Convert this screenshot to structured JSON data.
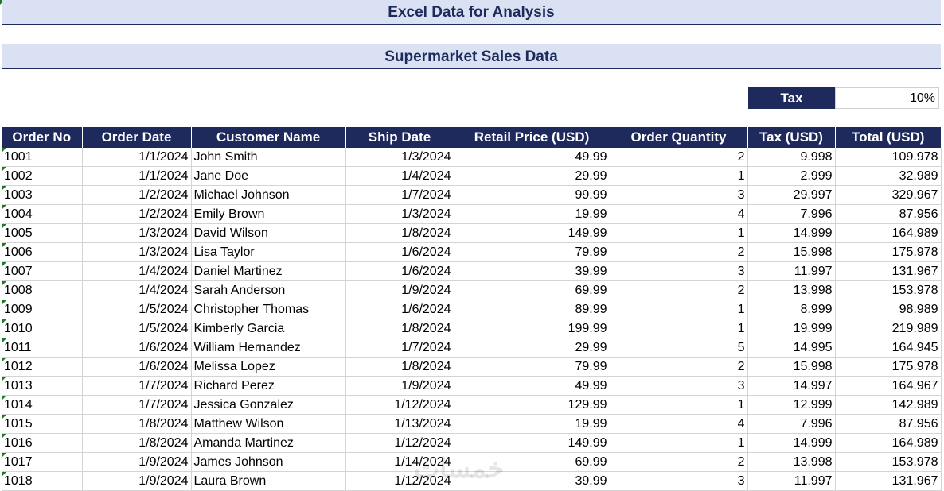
{
  "title": "Excel Data for Analysis",
  "subtitle": "Supermarket Sales Data",
  "tax": {
    "label": "Tax",
    "value": "10%"
  },
  "table": {
    "headers": [
      "Order No",
      "Order Date",
      "Customer Name",
      "Ship Date",
      "Retail Price (USD)",
      "Order Quantity",
      "Tax (USD)",
      "Total (USD)"
    ],
    "rows": [
      [
        "1001",
        "1/1/2024",
        "John Smith",
        "1/3/2024",
        "49.99",
        "2",
        "9.998",
        "109.978"
      ],
      [
        "1002",
        "1/1/2024",
        "Jane Doe",
        "1/4/2024",
        "29.99",
        "1",
        "2.999",
        "32.989"
      ],
      [
        "1003",
        "1/2/2024",
        "Michael Johnson",
        "1/7/2024",
        "99.99",
        "3",
        "29.997",
        "329.967"
      ],
      [
        "1004",
        "1/2/2024",
        "Emily Brown",
        "1/3/2024",
        "19.99",
        "4",
        "7.996",
        "87.956"
      ],
      [
        "1005",
        "1/3/2024",
        "David Wilson",
        "1/8/2024",
        "149.99",
        "1",
        "14.999",
        "164.989"
      ],
      [
        "1006",
        "1/3/2024",
        "Lisa Taylor",
        "1/6/2024",
        "79.99",
        "2",
        "15.998",
        "175.978"
      ],
      [
        "1007",
        "1/4/2024",
        "Daniel Martinez",
        "1/6/2024",
        "39.99",
        "3",
        "11.997",
        "131.967"
      ],
      [
        "1008",
        "1/4/2024",
        "Sarah Anderson",
        "1/9/2024",
        "69.99",
        "2",
        "13.998",
        "153.978"
      ],
      [
        "1009",
        "1/5/2024",
        "Christopher Thomas",
        "1/6/2024",
        "89.99",
        "1",
        "8.999",
        "98.989"
      ],
      [
        "1010",
        "1/5/2024",
        "Kimberly Garcia",
        "1/8/2024",
        "199.99",
        "1",
        "19.999",
        "219.989"
      ],
      [
        "1011",
        "1/6/2024",
        "William Hernandez",
        "1/7/2024",
        "29.99",
        "5",
        "14.995",
        "164.945"
      ],
      [
        "1012",
        "1/6/2024",
        "Melissa Lopez",
        "1/8/2024",
        "79.99",
        "2",
        "15.998",
        "175.978"
      ],
      [
        "1013",
        "1/7/2024",
        "Richard Perez",
        "1/9/2024",
        "49.99",
        "3",
        "14.997",
        "164.967"
      ],
      [
        "1014",
        "1/7/2024",
        "Jessica Gonzalez",
        "1/12/2024",
        "129.99",
        "1",
        "12.999",
        "142.989"
      ],
      [
        "1015",
        "1/8/2024",
        "Matthew Wilson",
        "1/13/2024",
        "19.99",
        "4",
        "7.996",
        "87.956"
      ],
      [
        "1016",
        "1/8/2024",
        "Amanda Martinez",
        "1/12/2024",
        "149.99",
        "1",
        "14.999",
        "164.989"
      ],
      [
        "1017",
        "1/9/2024",
        "James Johnson",
        "1/14/2024",
        "69.99",
        "2",
        "13.998",
        "153.978"
      ],
      [
        "1018",
        "1/9/2024",
        "Laura Brown",
        "1/12/2024",
        "39.99",
        "3",
        "11.997",
        "131.967"
      ]
    ]
  },
  "colors": {
    "header_bg": "#1f2a5c",
    "banner_bg": "#d9e1f2",
    "grid": "#d4d4d4",
    "indicator": "#1e7a1e"
  },
  "watermark": "خمسات"
}
